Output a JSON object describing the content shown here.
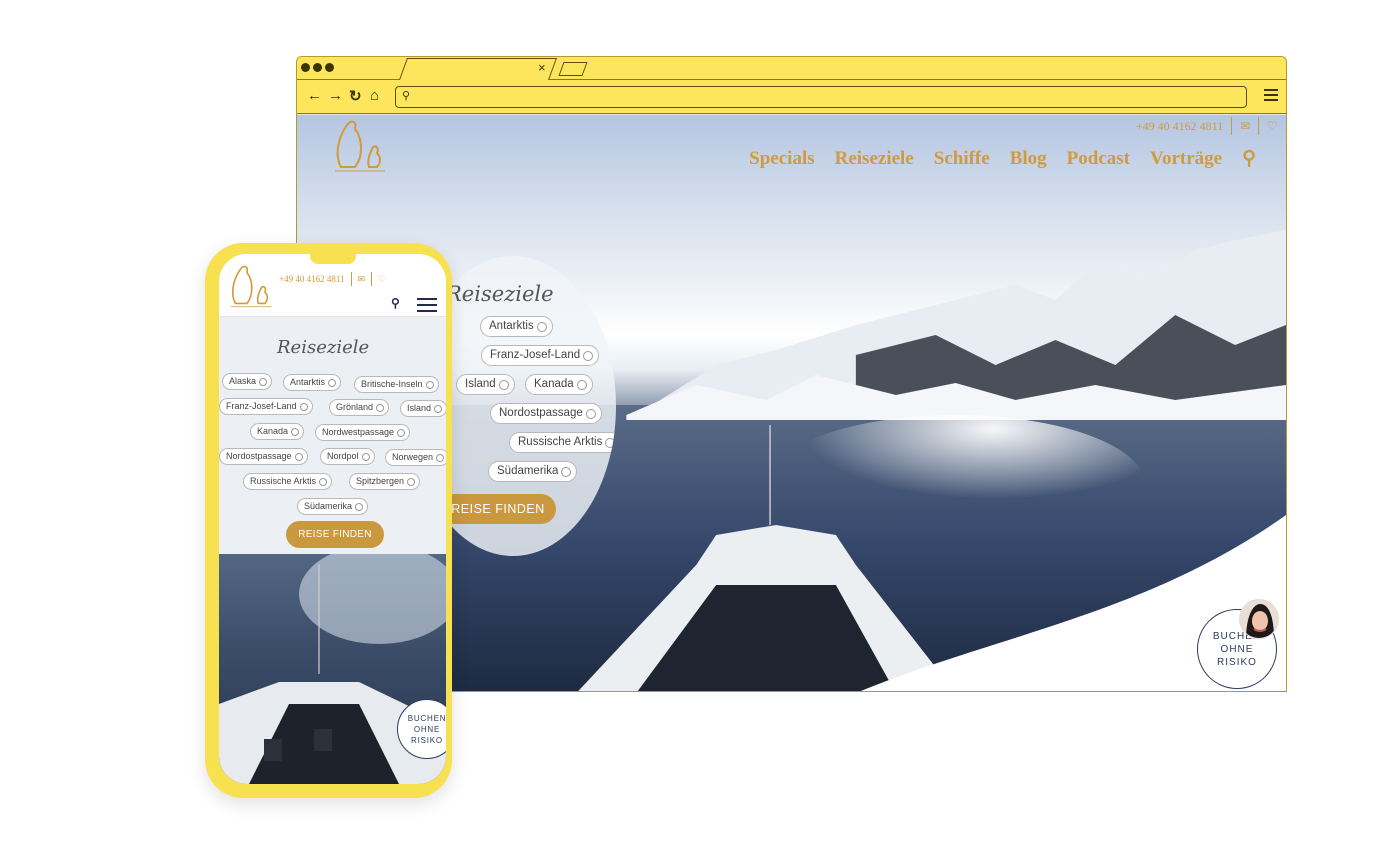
{
  "desktop": {
    "contact": {
      "phone": "+49 40 4162 4811",
      "mail_icon": "mail-icon",
      "heart_icon": "heart-icon"
    },
    "nav": [
      "Specials",
      "Reiseziele",
      "Schiffe",
      "Blog",
      "Podcast",
      "Vorträge"
    ],
    "search_icon": "search-icon",
    "destinations_title": "Reiseziele",
    "destinations": [
      "Antarktis",
      "Franz-Josef-Land",
      "Island",
      "Kanada",
      "Nordostpassage",
      "Russische Arktis",
      "Südamerika"
    ],
    "find_button": "REISE FINDEN",
    "badge": {
      "line1": "BUCHEN",
      "line2": "OHNE",
      "line3": "RISIKO"
    }
  },
  "mobile": {
    "contact": {
      "phone": "+49 40 4162 4811"
    },
    "destinations_title": "Reiseziele",
    "destinations": [
      "Alaska",
      "Antarktis",
      "Britische-Inseln",
      "Franz-Josef-Land",
      "Grönland",
      "Island",
      "Kanada",
      "Nordwestpassage",
      "Nordostpassage",
      "Nordpol",
      "Norwegen",
      "Russische Arktis",
      "Spitzbergen",
      "Südamerika"
    ],
    "find_button": "REISE FINDEN",
    "badge": {
      "line1": "BUCHEN",
      "line2": "OHNE",
      "line3": "RISIKO"
    }
  },
  "colors": {
    "accent": "#d19a3e",
    "button": "#c9983f",
    "navy": "#2e3b5c",
    "frame": "#fde65b"
  }
}
